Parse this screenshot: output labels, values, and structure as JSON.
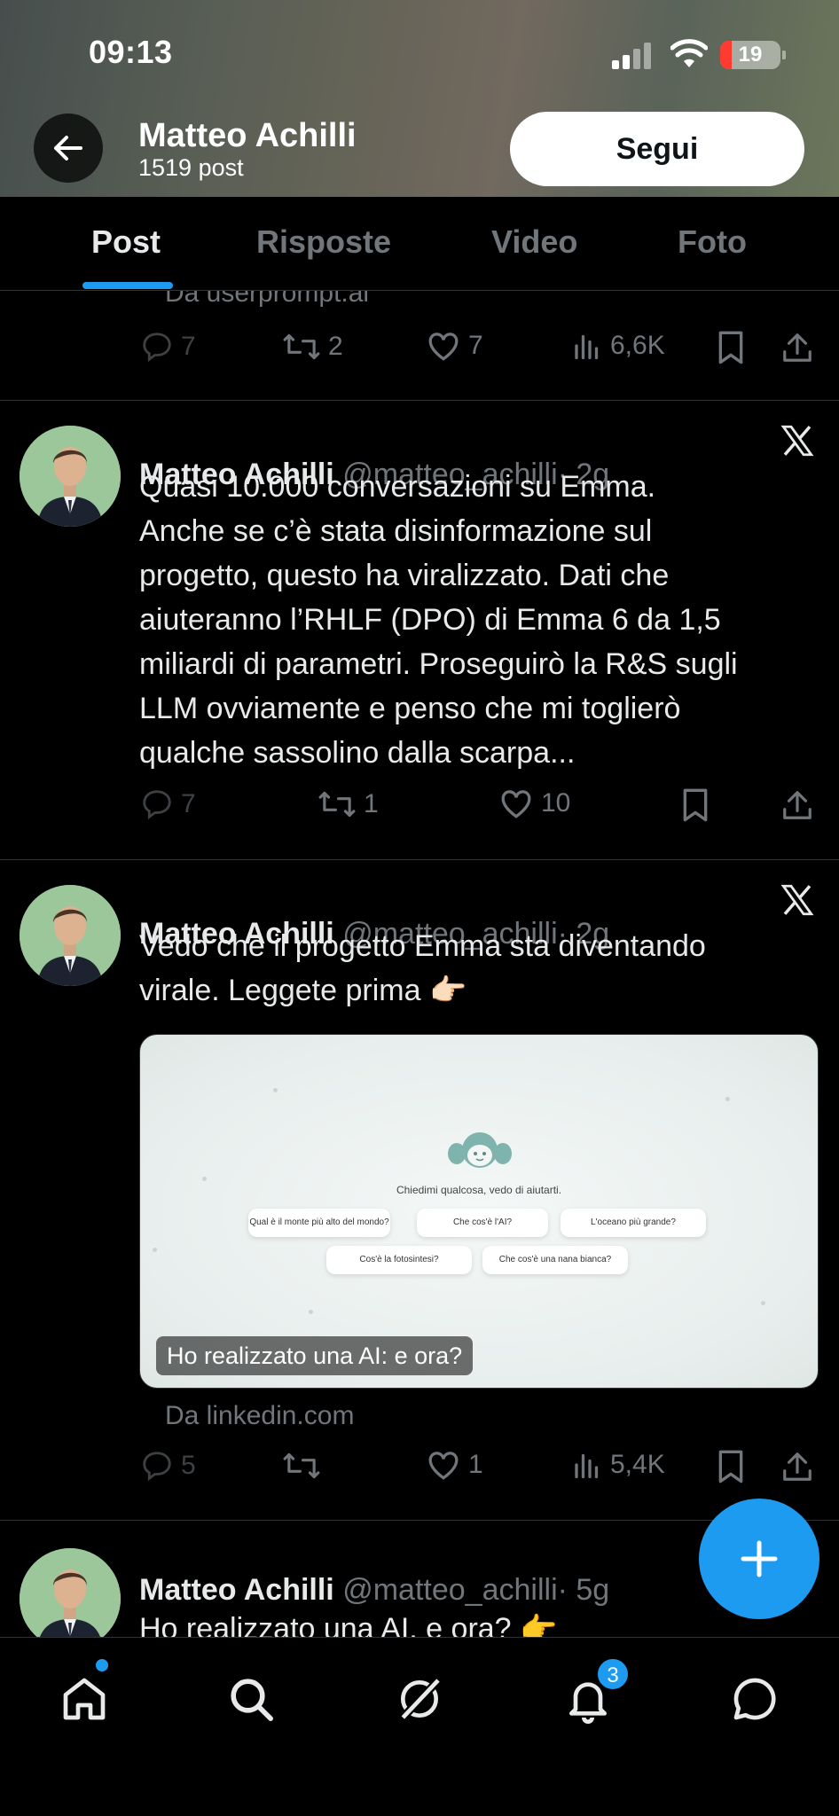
{
  "status_bar": {
    "time": "09:13",
    "battery": "19"
  },
  "header": {
    "name": "Matteo Achilli",
    "post_count": "1519 post",
    "follow_label": "Segui"
  },
  "tabs": [
    {
      "label": "Post",
      "active": true
    },
    {
      "label": "Risposte"
    },
    {
      "label": "Video"
    },
    {
      "label": "Foto"
    }
  ],
  "partial_tweet": {
    "source": "Da userprompt.ai",
    "replies": "7",
    "reposts": "2",
    "likes": "7",
    "views": "6,6K"
  },
  "tweets": [
    {
      "name": "Matteo Achilli",
      "handle": "@matteo_achilli",
      "time": "· 2g",
      "text_lines": [
        "Quasi 10.000 conversazioni su Emma.",
        "Anche se c’è stata disinformazione sul",
        "progetto, questo ha viralizzato. Dati che",
        "aiuteranno l’RHLF (DPO) di Emma 6 da 1,5",
        "miliardi di parametri. Proseguirò la R&S sugli",
        "LLM ovviamente e penso che mi toglierò",
        "qualche sassolino dalla scarpa..."
      ],
      "replies": "7",
      "reposts": "1",
      "likes": "10"
    },
    {
      "name": "Matteo Achilli",
      "handle": "@matteo_achilli",
      "time": "· 2g",
      "text_lines": [
        "Vedo che il progetto Emma sta diventando",
        "virale. Leggete prima 👉🏻"
      ],
      "media": {
        "prompt": "Chiedimi qualcosa, vedo di aiutarti.",
        "chips": [
          "Qual è il monte più alto del mondo?",
          "Che cos'è l'AI?",
          "L'oceano più grande?",
          "Cos'è la fotosintesi?",
          "Che cos'è una nana bianca?"
        ],
        "caption": "Ho realizzato una AI: e ora?"
      },
      "source": "Da linkedin.com",
      "replies": "5",
      "reposts": "",
      "likes": "1",
      "views": "5,4K"
    },
    {
      "name": "Matteo Achilli",
      "handle": "@matteo_achilli",
      "time": "· 5g",
      "text_lines": [
        "Ho realizzato una AI, e ora? 👉"
      ]
    }
  ],
  "bottom_nav": {
    "notifications_count": "3"
  },
  "colors": {
    "accent": "#1d9bf0",
    "background": "#000000",
    "muted": "#71767b"
  }
}
